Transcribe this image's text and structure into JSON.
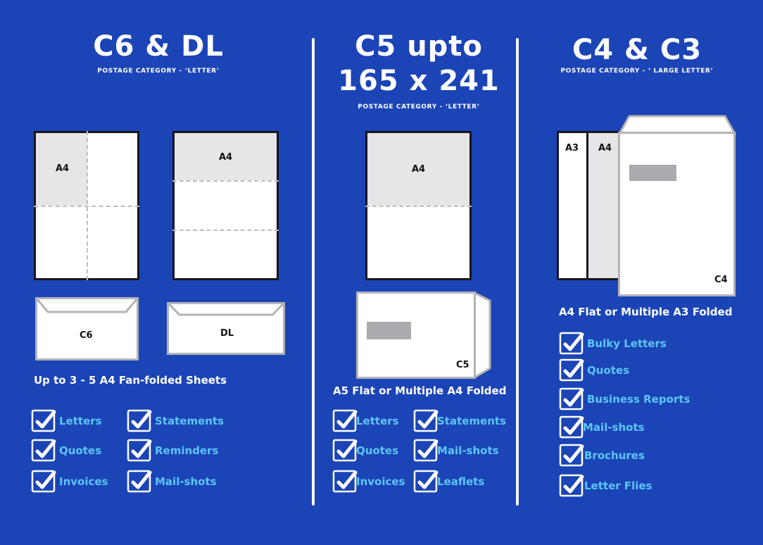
{
  "colors": {
    "background": "#1b44b6",
    "heading": "#ffffff",
    "list_text": "#5cc5f7",
    "paper_shade": "#e6e6e8",
    "envelope_border": "#b4b4b8",
    "window": "#aaaaaf"
  },
  "columns": [
    {
      "title_lines": [
        "C6 & DL"
      ],
      "subtitle": "POSTAGE CATEGORY - ‘LETTER’",
      "papers": [
        {
          "label": "A4",
          "folding": "quarter-fold"
        },
        {
          "label": "A4",
          "folding": "tri-fold"
        }
      ],
      "envelopes": [
        {
          "label": "C6",
          "icon": "envelope-flap-icon"
        },
        {
          "label": "DL",
          "icon": "envelope-flap-icon"
        }
      ],
      "caption": "Up to 3 - 5 A4 Fan-folded Sheets",
      "items": [
        "Letters",
        "Quotes",
        "Invoices",
        "Statements",
        "Reminders",
        "Mail-shots"
      ]
    },
    {
      "title_lines": [
        "C5 upto",
        "165 x 241"
      ],
      "subtitle": "POSTAGE CATEGORY - ‘LETTER’",
      "papers": [
        {
          "label": "A4",
          "folding": "half-fold"
        }
      ],
      "envelopes": [
        {
          "label": "C5",
          "icon": "window-envelope-icon"
        }
      ],
      "caption": "A5 Flat or Multiple A4 Folded",
      "items": [
        "Letters",
        "Quotes",
        "Invoices",
        "Statements",
        "Mail-shots",
        "Leaflets"
      ]
    },
    {
      "title_lines": [
        "C4 & C3"
      ],
      "subtitle": "POSTAGE CATEGORY - ‘ LARGE LETTER’",
      "papers": [
        {
          "label": "A3",
          "folding": "flat"
        },
        {
          "label": "A4",
          "folding": "flat"
        }
      ],
      "envelopes": [
        {
          "label": "C4",
          "icon": "window-envelope-icon"
        }
      ],
      "caption": "A4 Flat or Multiple A3 Folded",
      "items": [
        "Bulky Letters",
        "Quotes",
        "Business Reports",
        "Mail-shots",
        "Brochures",
        "Letter Flies"
      ]
    }
  ]
}
